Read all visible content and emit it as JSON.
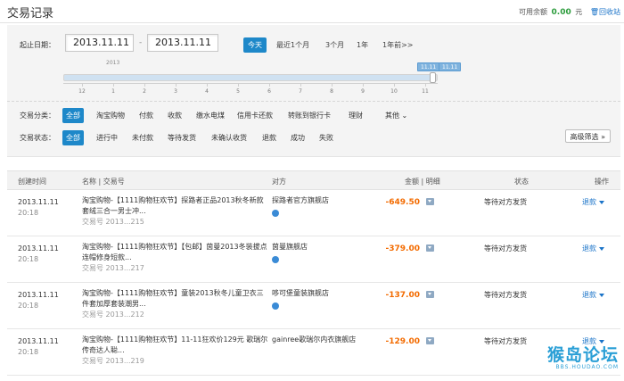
{
  "header": {
    "title": "交易记录",
    "balance_label": "可用余额",
    "balance_value": "0.00",
    "balance_unit": "元",
    "recycle": "回收站"
  },
  "filters": {
    "date_label": "起止日期：",
    "start_date": "2013.11.11",
    "end_date": "2013.11.11",
    "quick": [
      "今天",
      "最近1个月",
      "3个月",
      "1年",
      "1年前>>"
    ],
    "timeline": {
      "year_mark": "2013",
      "ticks": [
        "12",
        "1",
        "2",
        "3",
        "4",
        "5",
        "6",
        "7",
        "8",
        "9",
        "10",
        "11"
      ],
      "tip_left": "11.11",
      "tip_right": "11.11",
      "selected_fraction": 0.99
    },
    "category_label": "交易分类：",
    "categories": [
      "全部",
      "淘宝购物",
      "付款",
      "收款",
      "缴水电煤",
      "信用卡还款",
      "转账到银行卡",
      "理财",
      "其他"
    ],
    "status_label": "交易状态：",
    "statuses": [
      "全部",
      "进行中",
      "未付款",
      "等待发货",
      "未确认收货",
      "退款",
      "成功",
      "失败"
    ],
    "advanced": "高级筛选"
  },
  "table": {
    "headers": {
      "created": "创建时间",
      "name": "名称 | 交易号",
      "party": "对方",
      "amount": "金额 | 明细",
      "status": "状态",
      "action": "操作"
    },
    "rows": [
      {
        "date": "2013.11.11",
        "time": "20:18",
        "name": "淘宝购物-【1111购物狂欢节】探路者正品2013秋冬新款套绒三合一男士冲...",
        "trade_no": "交易号 2013...215",
        "party": "探路者官方旗舰店",
        "amount": "-649.50",
        "status": "等待对方发货",
        "action": "退款"
      },
      {
        "date": "2013.11.11",
        "time": "20:18",
        "name": "淘宝购物-【1111购物狂欢节】【包邮】茵曼2013冬装拔点连帽修身短款...",
        "trade_no": "交易号 2013...217",
        "party": "茵曼旗舰店",
        "amount": "-379.00",
        "status": "等待对方发货",
        "action": "退款"
      },
      {
        "date": "2013.11.11",
        "time": "20:18",
        "name": "淘宝购物-【1111购物狂欢节】童装2013秋冬儿童卫衣三件套加厚套装潮男...",
        "trade_no": "交易号 2013...212",
        "party": "哆可堡童装旗舰店",
        "amount": "-137.00",
        "status": "等待对方发货",
        "action": "退款"
      },
      {
        "date": "2013.11.11",
        "time": "20:18",
        "name": "淘宝购物-【1111购物狂欢节】11-11狂欢价129元 歌瑞尔传奇达人聪...",
        "trade_no": "交易号 2013...219",
        "party": "gainree歌瑞尔内衣旗舰店",
        "amount": "-129.00",
        "status": "等待对方发货",
        "action": "退款"
      }
    ]
  },
  "watermark": {
    "big": "猴岛论坛",
    "small": "BBS.HOUDAO.COM"
  },
  "colors": {
    "accent": "#1e88c9",
    "amount": "#f36b00",
    "balance": "#2c9c3c",
    "link": "#1a73c8"
  }
}
